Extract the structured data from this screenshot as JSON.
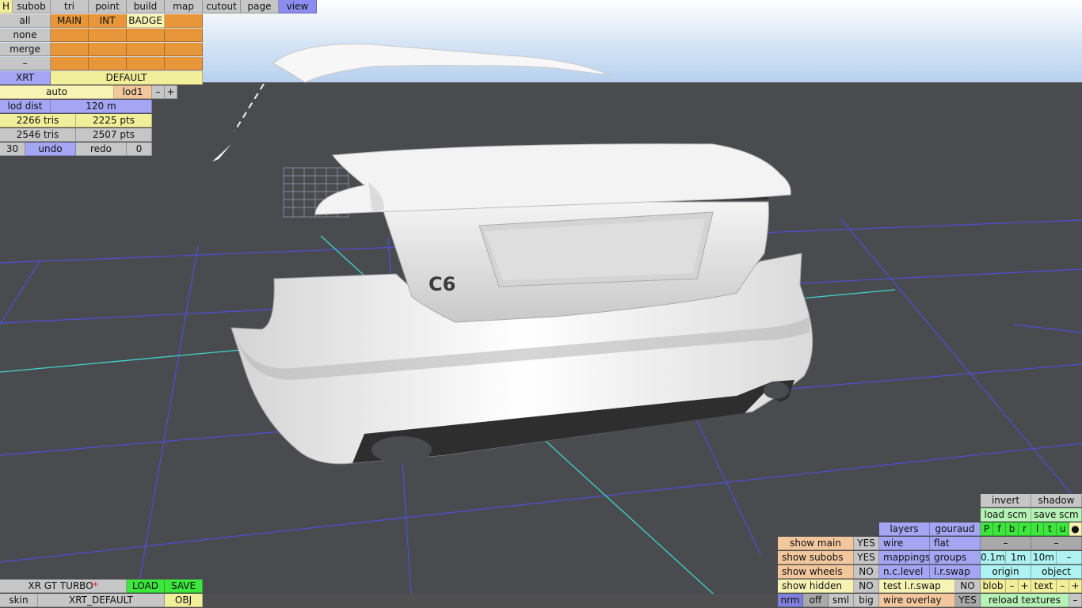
{
  "menu": {
    "h": "H",
    "items": [
      "subob",
      "tri",
      "point",
      "build",
      "map",
      "cutout",
      "page",
      "view"
    ],
    "active": "view"
  },
  "left_panel": {
    "all": "all",
    "none": "none",
    "merge": "merge",
    "dash": "–",
    "layers": [
      "MAIN",
      "INT",
      "BADGE"
    ],
    "xrt": "XRT",
    "default": "DEFAULT",
    "auto": "auto",
    "lod1": "lod1",
    "minus": "–",
    "plus": "+",
    "lod_dist_label": "lod dist",
    "lod_dist_value": "120 m",
    "tris_a": "2266 tris",
    "pts_a": "2225 pts",
    "tris_b": "2546 tris",
    "pts_b": "2507 pts",
    "undo_count": "30",
    "undo": "undo",
    "redo": "redo",
    "redo_count": "0"
  },
  "bottom_left": {
    "car_name": "XR GT TURBO",
    "modified_mark": "*",
    "load": "LOAD",
    "save": "SAVE",
    "skin": "skin",
    "skin_name": "XRT_DEFAULT",
    "obj": "OBJ"
  },
  "scene": {
    "badge_text": "C6",
    "sky_color": "#bdd4f0",
    "floor_color": "#4a4b4f",
    "grid_color": "#4f4fd8",
    "axis_color": "#3fd6cf"
  },
  "bottom_right": {
    "invert": "invert",
    "shadow": "shadow",
    "load_scm": "load scm",
    "save_scm": "save scm",
    "layers": "layers",
    "gouraud": "gouraud",
    "letters": [
      "P",
      "f",
      "b",
      "r",
      "l",
      "t",
      "u",
      "●"
    ],
    "show_main": "show main",
    "show_main_val": "YES",
    "wire": "wire",
    "flat": "flat",
    "dash1": "–",
    "dash2": "–",
    "show_subobs": "show subobs",
    "show_subobs_val": "YES",
    "mappings": "mappings",
    "groups": "groups",
    "dist_01": "0.1m",
    "dist_1": "1m",
    "dist_10": "10m",
    "dist_minus": "–",
    "show_wheels": "show wheels",
    "show_wheels_val": "NO",
    "nc_level": "n.c.level",
    "lr_swap": "l.r.swap",
    "origin": "origin",
    "object": "object",
    "show_hidden": "show hidden",
    "show_hidden_val": "NO",
    "test_lr_swap": "test l.r.swap",
    "test_lr_swap_val": "NO",
    "blob": "blob",
    "blob_minus": "–",
    "blob_plus": "+",
    "text": "text",
    "text_minus": "–",
    "text_plus": "+",
    "nrm": "nrm",
    "off": "off",
    "sml": "sml",
    "big": "big",
    "wire_overlay": "wire overlay",
    "wire_overlay_val": "YES",
    "reload_textures": "reload textures",
    "reload_minus": "–"
  }
}
